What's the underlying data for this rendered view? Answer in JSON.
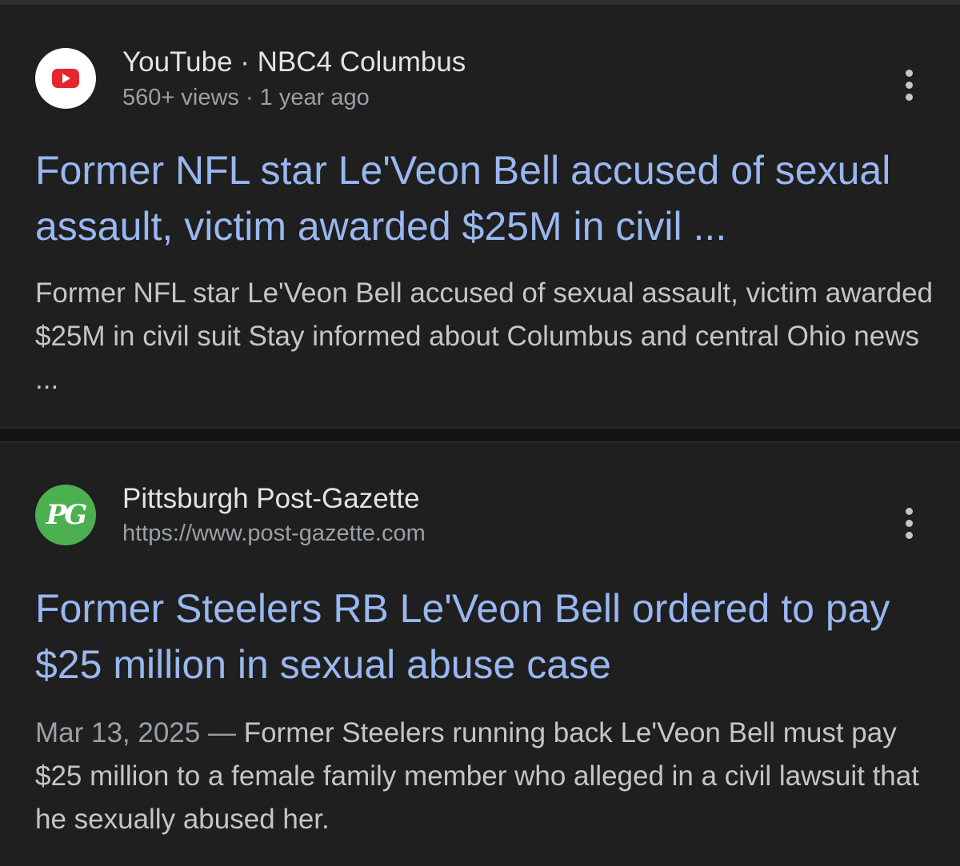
{
  "results": [
    {
      "favicon_icon": "youtube-icon",
      "source": "YouTube · NBC4 Columbus",
      "meta": "560+ views · 1 year ago",
      "title": "Former NFL star Le'Veon Bell accused of sexual assault, victim awarded $25M in civil ...",
      "snippet": "Former NFL star Le'Veon Bell accused of sexual assault, victim awarded $25M in civil suit Stay informed about Columbus and central Ohio news ...",
      "more_icon": "more-vert-icon"
    },
    {
      "favicon_icon": "post-gazette-icon",
      "favicon_text": "PG",
      "source": "Pittsburgh Post-Gazette",
      "meta": "https://www.post-gazette.com",
      "title": "Former Steelers RB Le'Veon Bell ordered to pay $25 million in sexual abuse case",
      "snippet_date": "Mar 13, 2025 — ",
      "snippet": "Former Steelers running back Le'Veon Bell must pay $25 million to a female family member who alleged in a civil lawsuit that he sexually abused her.",
      "more_icon": "more-vert-icon"
    }
  ],
  "colors": {
    "background": "#1f1f1f",
    "title_link": "#99b7f0",
    "source_text": "#e3e3e3",
    "meta_text": "#9aa0a6",
    "snippet_text": "#c3c6c9",
    "youtube_red": "#e5272d",
    "post_gazette_green": "#4caf50"
  }
}
